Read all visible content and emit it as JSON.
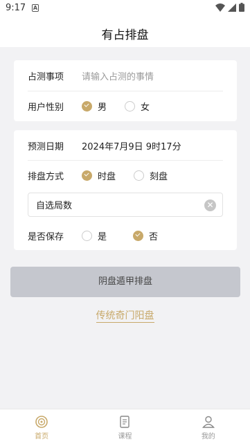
{
  "status_bar": {
    "time": "9:17",
    "notification_icon": "A"
  },
  "app_bar": {
    "title": "有占排盘"
  },
  "form1": {
    "matter_label": "占测事项",
    "matter_placeholder": "请输入占测的事情",
    "gender_label": "用户性别",
    "gender_options": [
      "男",
      "女"
    ],
    "gender_selected": "男"
  },
  "form2": {
    "date_label": "预测日期",
    "date_value": "2024年7月9日 9时17分",
    "method_label": "排盘方式",
    "method_options": [
      "时盘",
      "刻盘"
    ],
    "method_selected": "时盘",
    "custom_ju_placeholder": "自选局数",
    "save_label": "是否保存",
    "save_options": [
      "是",
      "否"
    ],
    "save_selected": "否"
  },
  "actions": {
    "submit_label": "阴盘遁甲排盘",
    "link_label": "传统奇门阳盘"
  },
  "tabs": [
    {
      "label": "首页",
      "icon": "home-seal-icon",
      "active": true
    },
    {
      "label": "课程",
      "icon": "document-icon",
      "active": false
    },
    {
      "label": "我的",
      "icon": "user-icon",
      "active": false
    }
  ],
  "colors": {
    "accent": "#c8a96a",
    "background": "#f2f2f4",
    "button_disabled": "#c5c7ce"
  }
}
